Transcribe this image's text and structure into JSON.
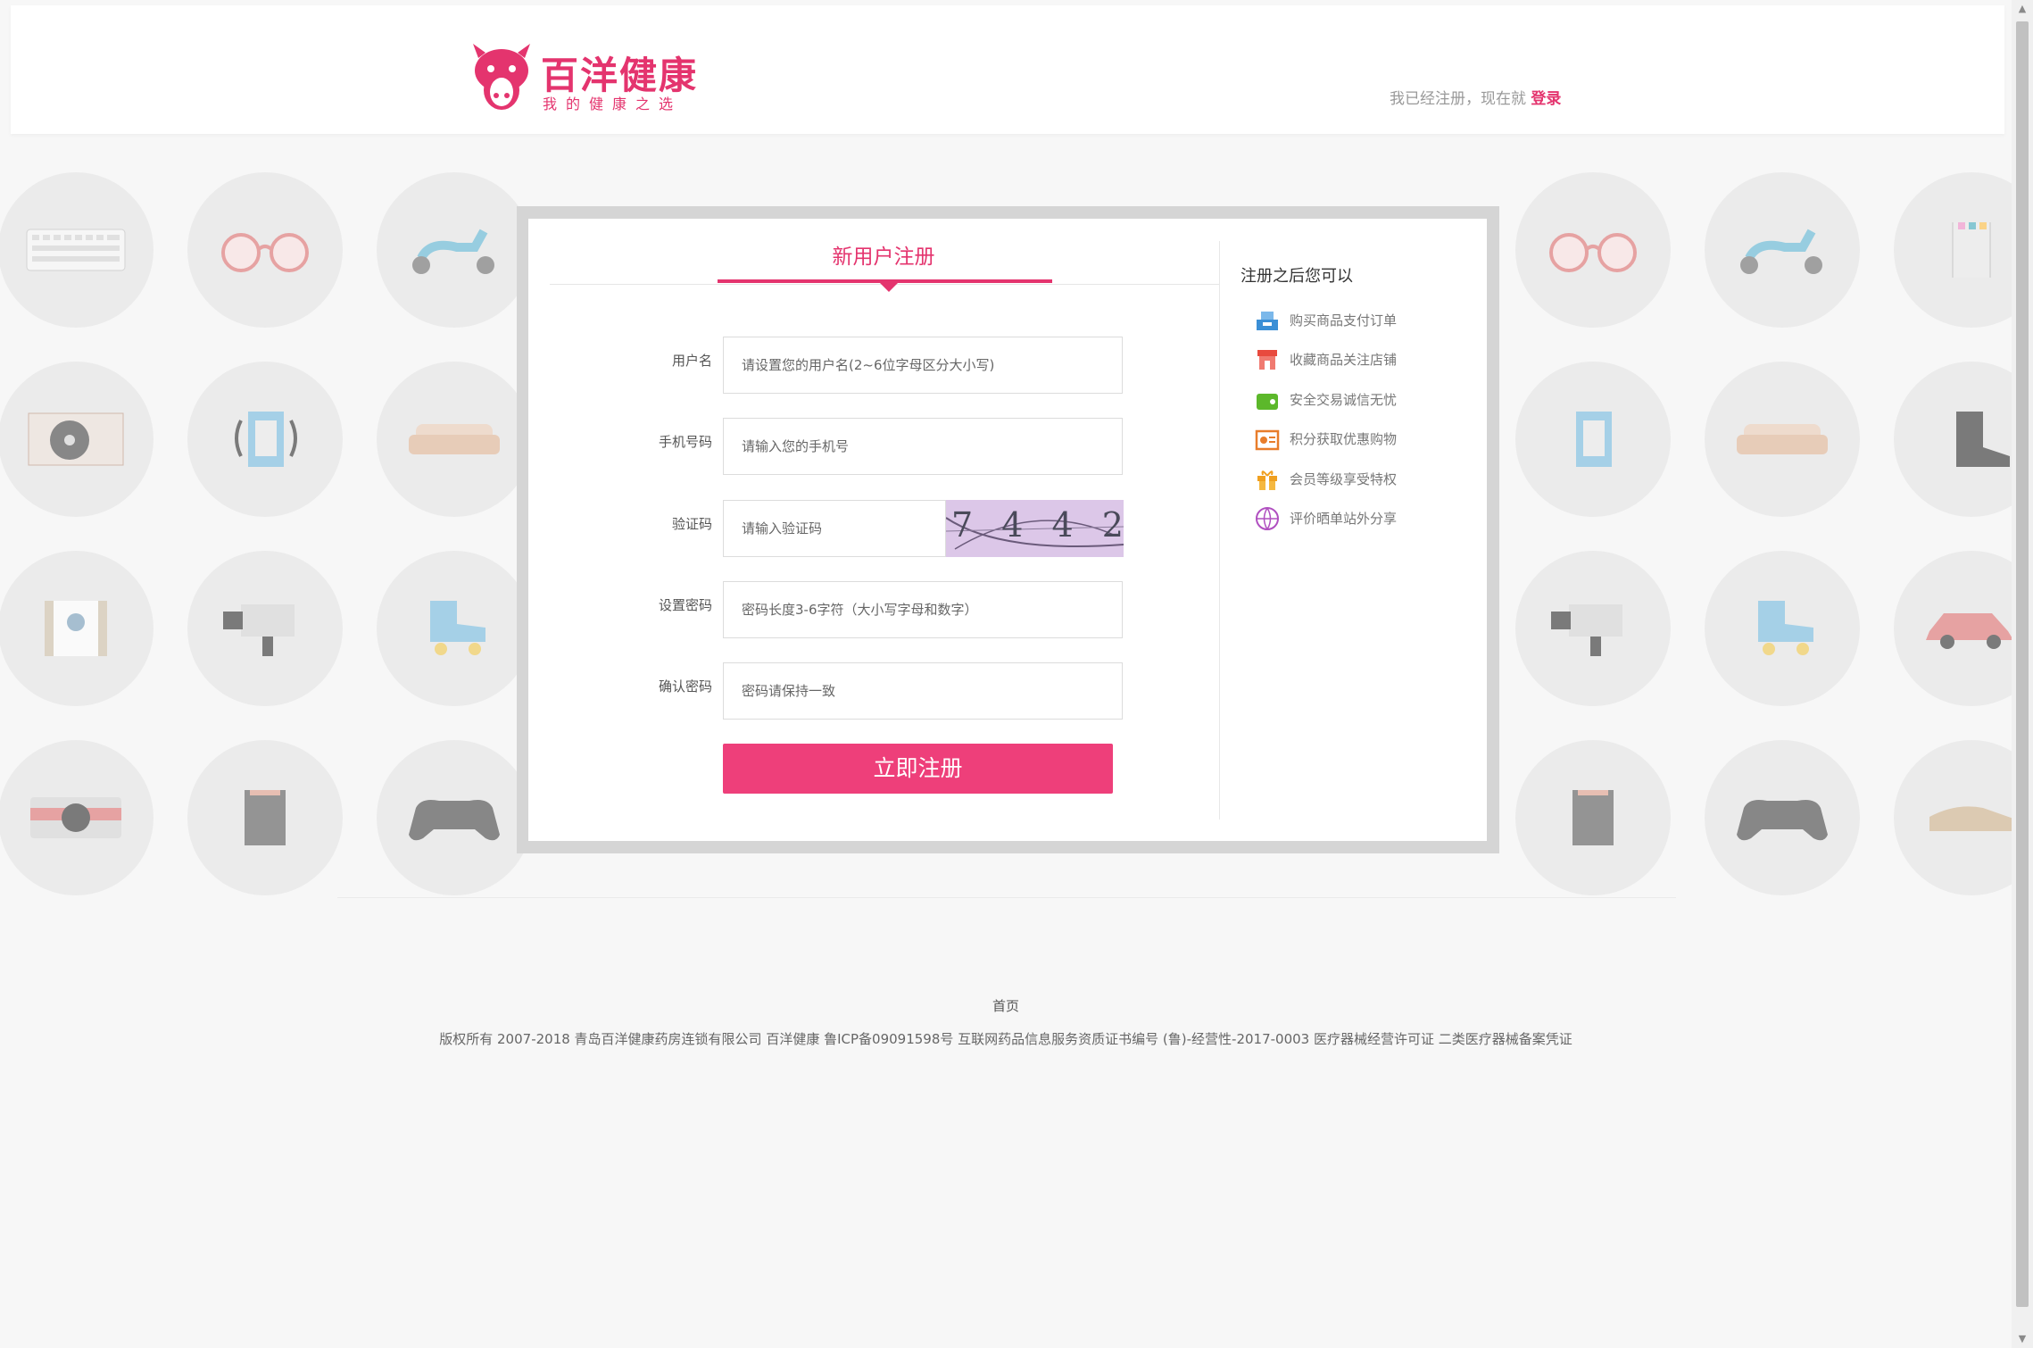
{
  "header": {
    "brand": "百洋健康",
    "slogan": "我的健康之选",
    "login_prompt": "我已经注册，现在就",
    "login_link": "登录"
  },
  "register": {
    "title": "新用户注册",
    "fields": [
      {
        "label": "用户名",
        "placeholder": "请设置您的用户名(2~6位字母区分大小写)"
      },
      {
        "label": "手机号码",
        "placeholder": "请输入您的手机号"
      },
      {
        "label": "验证码",
        "placeholder": "请输入验证码"
      },
      {
        "label": "设置密码",
        "placeholder": "密码长度3-6字符（大小写字母和数字）"
      },
      {
        "label": "确认密码",
        "placeholder": "密码请保持一致"
      }
    ],
    "captcha_text": "7 4 4 2",
    "submit_label": "立即注册"
  },
  "benefits": {
    "title": "注册之后您可以",
    "items": [
      {
        "icon": "cash-register-icon",
        "label": "购买商品支付订单",
        "color": "#3b8fd6"
      },
      {
        "icon": "store-icon",
        "label": "收藏商品关注店铺",
        "color": "#e84a3e"
      },
      {
        "icon": "wallet-icon",
        "label": "安全交易诚信无忧",
        "color": "#5cb82b"
      },
      {
        "icon": "points-icon",
        "label": "积分获取优惠购物",
        "color": "#e87d2b"
      },
      {
        "icon": "gift-icon",
        "label": "会员等级享受特权",
        "color": "#f0a020"
      },
      {
        "icon": "share-globe-icon",
        "label": "评价晒单站外分享",
        "color": "#b04fc0"
      }
    ]
  },
  "footer": {
    "home_link": "首页",
    "copyright": "版权所有 2007-2018 青岛百洋健康药房连锁有限公司 百洋健康 鲁ICP备09091598号 互联网药品信息服务资质证书编号 (鲁)-经营性-2017-0003 医疗器械经营许可证 二类医疗器械备案凭证"
  },
  "colors": {
    "brand": "#e4346e",
    "button": "#ee3f7a"
  }
}
